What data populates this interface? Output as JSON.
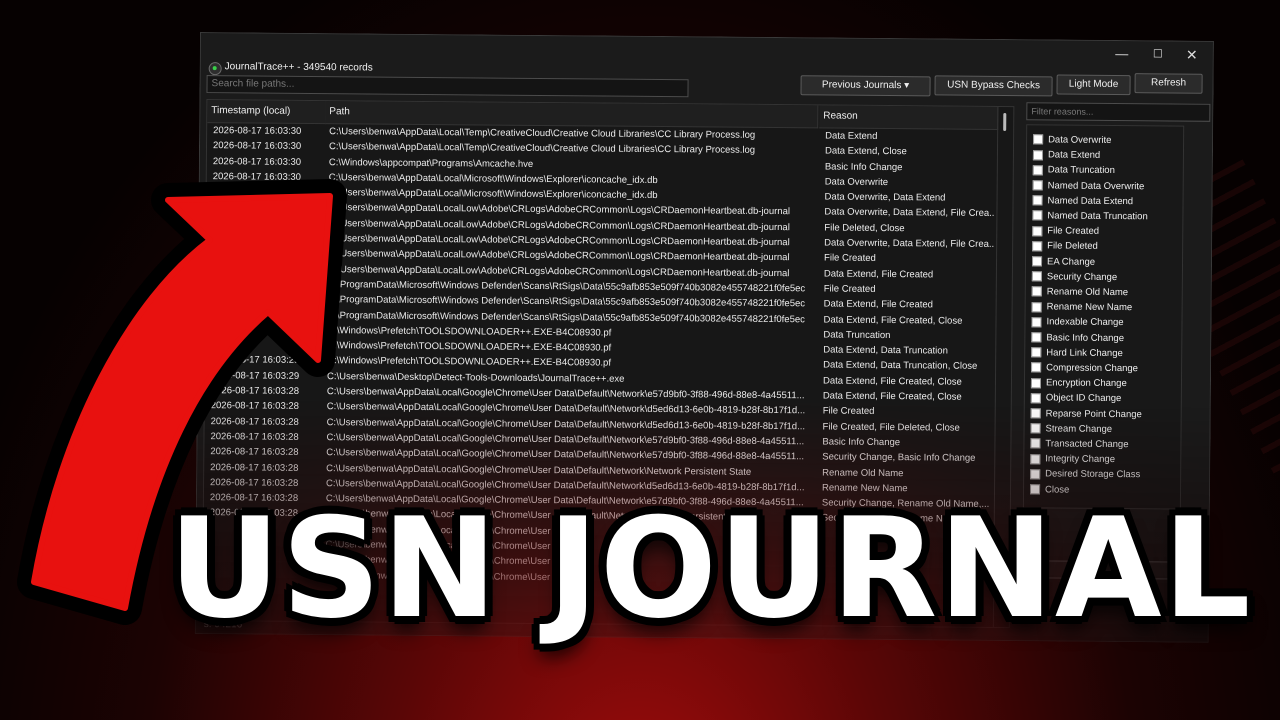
{
  "window": {
    "title": "JournalTrace++ - 349540 records",
    "controls": {
      "minimize": "—",
      "maximize": "☐",
      "close": "✕"
    }
  },
  "toolbar": {
    "previous_journals": "Previous Journals ▾",
    "usn_bypass": "USN Bypass Checks",
    "light_mode": "Light Mode",
    "refresh": "Refresh"
  },
  "search": {
    "placeholder": "Search file paths..."
  },
  "filter": {
    "placeholder": "Filter reasons..."
  },
  "table": {
    "headers": {
      "timestamp": "Timestamp (local)",
      "path": "Path",
      "reason": "Reason"
    },
    "rows": [
      {
        "ts": "2026-08-17 16:03:30",
        "path": "C:\\Users\\benwa\\AppData\\Local\\Temp\\CreativeCloud\\Creative Cloud Libraries\\CC Library Process.log",
        "reason": "Data Extend"
      },
      {
        "ts": "2026-08-17 16:03:30",
        "path": "C:\\Users\\benwa\\AppData\\Local\\Temp\\CreativeCloud\\Creative Cloud Libraries\\CC Library Process.log",
        "reason": "Data Extend, Close"
      },
      {
        "ts": "2026-08-17 16:03:30",
        "path": "C:\\Windows\\appcompat\\Programs\\Amcache.hve",
        "reason": "Basic Info Change"
      },
      {
        "ts": "2026-08-17 16:03:30",
        "path": "C:\\Users\\benwa\\AppData\\Local\\Microsoft\\Windows\\Explorer\\iconcache_idx.db",
        "reason": "Data Overwrite"
      },
      {
        "ts": "2026-08-17 16:03:30",
        "path": "C:\\Users\\benwa\\AppData\\Local\\Microsoft\\Windows\\Explorer\\iconcache_idx.db",
        "reason": "Data Overwrite, Data Extend"
      },
      {
        "ts": "",
        "path": "C:\\Users\\benwa\\AppData\\LocalLow\\Adobe\\CRLogs\\AdobeCRCommon\\Logs\\CRDaemonHeartbeat.db-journal",
        "reason": "Data Overwrite, Data Extend, File Crea..."
      },
      {
        "ts": "",
        "path": "C:\\Users\\benwa\\AppData\\LocalLow\\Adobe\\CRLogs\\AdobeCRCommon\\Logs\\CRDaemonHeartbeat.db-journal",
        "reason": "File Deleted, Close"
      },
      {
        "ts": "",
        "path": "C:\\Users\\benwa\\AppData\\LocalLow\\Adobe\\CRLogs\\AdobeCRCommon\\Logs\\CRDaemonHeartbeat.db-journal",
        "reason": "Data Overwrite, Data Extend, File Crea..."
      },
      {
        "ts": "",
        "path": "C:\\Users\\benwa\\AppData\\LocalLow\\Adobe\\CRLogs\\AdobeCRCommon\\Logs\\CRDaemonHeartbeat.db-journal",
        "reason": "File Created"
      },
      {
        "ts": "",
        "path": "C:\\Users\\benwa\\AppData\\LocalLow\\Adobe\\CRLogs\\AdobeCRCommon\\Logs\\CRDaemonHeartbeat.db-journal",
        "reason": "Data Extend, File Created"
      },
      {
        "ts": "",
        "path": "C:\\ProgramData\\Microsoft\\Windows Defender\\Scans\\RtSigs\\Data\\55c9afb853e509f740b3082e455748221f0fe5ec",
        "reason": "File Created"
      },
      {
        "ts": "",
        "path": "C:\\ProgramData\\Microsoft\\Windows Defender\\Scans\\RtSigs\\Data\\55c9afb853e509f740b3082e455748221f0fe5ec",
        "reason": "Data Extend, File Created"
      },
      {
        "ts": "",
        "path": "C:\\ProgramData\\Microsoft\\Windows Defender\\Scans\\RtSigs\\Data\\55c9afb853e509f740b3082e455748221f0fe5ec",
        "reason": "Data Extend, File Created, Close"
      },
      {
        "ts": "",
        "path": "C:\\Windows\\Prefetch\\TOOLSDOWNLOADER++.EXE-B4C08930.pf",
        "reason": "Data Truncation"
      },
      {
        "ts": "",
        "path": "C:\\Windows\\Prefetch\\TOOLSDOWNLOADER++.EXE-B4C08930.pf",
        "reason": "Data Extend, Data Truncation"
      },
      {
        "ts": "2026-08-17 16:03:29",
        "path": "C:\\Windows\\Prefetch\\TOOLSDOWNLOADER++.EXE-B4C08930.pf",
        "reason": "Data Extend, Data Truncation, Close"
      },
      {
        "ts": "2026-08-17 16:03:29",
        "path": "C:\\Users\\benwa\\Desktop\\Detect-Tools-Downloads\\JournalTrace++.exe",
        "reason": "Data Extend, File Created, Close"
      },
      {
        "ts": "2026-08-17 16:03:28",
        "path": "C:\\Users\\benwa\\AppData\\Local\\Google\\Chrome\\User Data\\Default\\Network\\e57d9bf0-3f88-496d-88e8-4a45511...",
        "reason": "Data Extend, File Created, Close"
      },
      {
        "ts": "2026-08-17 16:03:28",
        "path": "C:\\Users\\benwa\\AppData\\Local\\Google\\Chrome\\User Data\\Default\\Network\\d5ed6d13-6e0b-4819-b28f-8b17f1d...",
        "reason": "File Created"
      },
      {
        "ts": "2026-08-17 16:03:28",
        "path": "C:\\Users\\benwa\\AppData\\Local\\Google\\Chrome\\User Data\\Default\\Network\\d5ed6d13-6e0b-4819-b28f-8b17f1d...",
        "reason": "File Created, File Deleted, Close"
      },
      {
        "ts": "2026-08-17 16:03:28",
        "path": "C:\\Users\\benwa\\AppData\\Local\\Google\\Chrome\\User Data\\Default\\Network\\e57d9bf0-3f88-496d-88e8-4a45511...",
        "reason": "Basic Info Change"
      },
      {
        "ts": "2026-08-17 16:03:28",
        "path": "C:\\Users\\benwa\\AppData\\Local\\Google\\Chrome\\User Data\\Default\\Network\\e57d9bf0-3f88-496d-88e8-4a45511...",
        "reason": "Security Change, Basic Info Change"
      },
      {
        "ts": "2026-08-17 16:03:28",
        "path": "C:\\Users\\benwa\\AppData\\Local\\Google\\Chrome\\User Data\\Default\\Network\\Network Persistent State",
        "reason": "Rename Old Name"
      },
      {
        "ts": "2026-08-17 16:03:28",
        "path": "C:\\Users\\benwa\\AppData\\Local\\Google\\Chrome\\User Data\\Default\\Network\\d5ed6d13-6e0b-4819-b28f-8b17f1d...",
        "reason": "Rename New Name"
      },
      {
        "ts": "2026-08-17 16:03:28",
        "path": "C:\\Users\\benwa\\AppData\\Local\\Google\\Chrome\\User Data\\Default\\Network\\e57d9bf0-3f88-496d-88e8-4a45511...",
        "reason": "Security Change, Rename Old Name,..."
      },
      {
        "ts": "2026-08-17 16:03:28",
        "path": "C:\\Users\\benwa\\AppData\\Local\\Google\\Chrome\\User Data\\Default\\Network\\Network Persistent State",
        "reason": "Security Change, Rename New Name"
      },
      {
        "ts": "",
        "path": "C:\\Users\\benwa\\AppData\\Local\\Google\\Chrome\\User Data",
        "reason": ""
      },
      {
        "ts": "",
        "path": "C:\\Users\\benwa\\AppData\\Local\\Google\\Chrome\\User Data",
        "reason": ""
      },
      {
        "ts": "",
        "path": "C:\\Users\\benwa\\AppData\\Local\\Google\\Chrome\\User Data",
        "reason": ""
      },
      {
        "ts": "",
        "path": "C:\\Users\\benwa\\AppData\\Local\\Google\\Chrome\\User Data",
        "reason": ""
      }
    ]
  },
  "reasons": [
    "Data Overwrite",
    "Data Extend",
    "Data Truncation",
    "Named Data Overwrite",
    "Named Data Extend",
    "Named Data Truncation",
    "File Created",
    "File Deleted",
    "EA Change",
    "Security Change",
    "Rename Old Name",
    "Rename New Name",
    "Indexable Change",
    "Basic Info Change",
    "Hard Link Change",
    "Compression Change",
    "Encryption Change",
    "Object ID Change",
    "Reparse Point Change",
    "Stream Change",
    "Transacted Change",
    "Integrity Change",
    "Desired Storage Class",
    "Close"
  ],
  "status": {
    "text": "s: 94216"
  },
  "overlay": {
    "headline": "USN JOURNAL",
    "arrow_color": "#e8110f"
  }
}
